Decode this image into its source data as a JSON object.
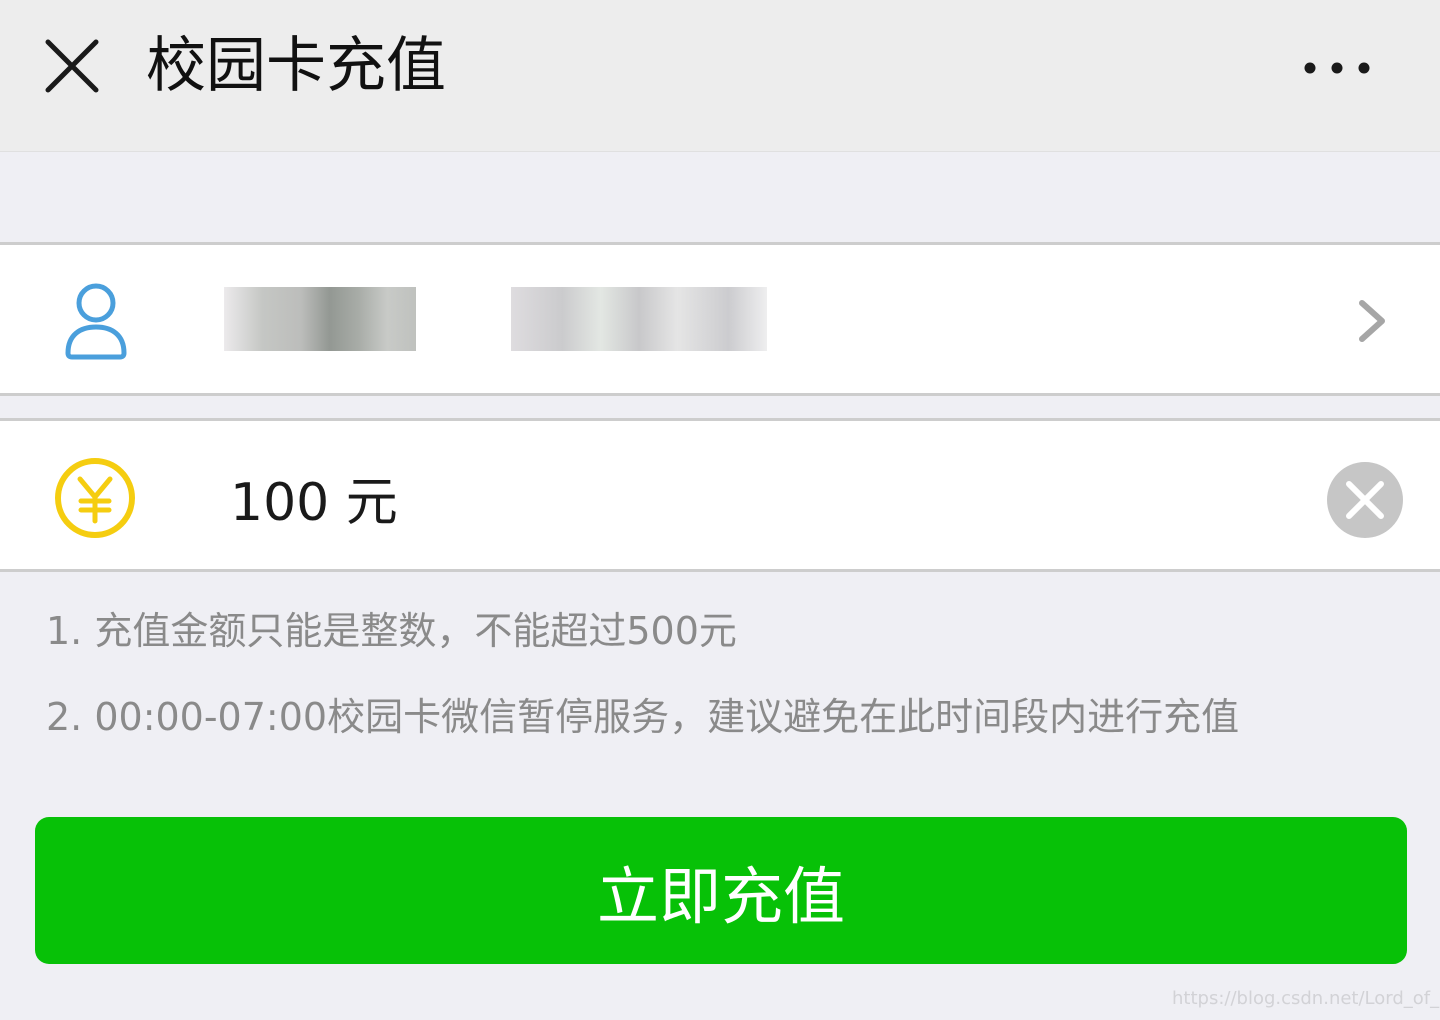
{
  "header": {
    "title": "校园卡充值",
    "close_icon": "close-icon",
    "more_icon": "more-icon"
  },
  "account_row": {
    "icon": "user-icon",
    "name_blurred": true,
    "id_blurred": true,
    "chevron_icon": "chevron-right-icon",
    "icon_color": "#4a9fdc"
  },
  "amount_row": {
    "icon": "yen-icon",
    "icon_color": "#f5cd10",
    "value": "100 元",
    "clear_icon": "clear-icon"
  },
  "notes": [
    "1. 充值金额只能是整数，不能超过500元",
    "2. 00:00-07:00校园卡微信暂停服务，建议避免在此时间段内进行充值"
  ],
  "submit": {
    "label": "立即充值",
    "color": "#07c107"
  },
  "watermark": "https://blog.csdn.net/Lord_of_Cinder"
}
